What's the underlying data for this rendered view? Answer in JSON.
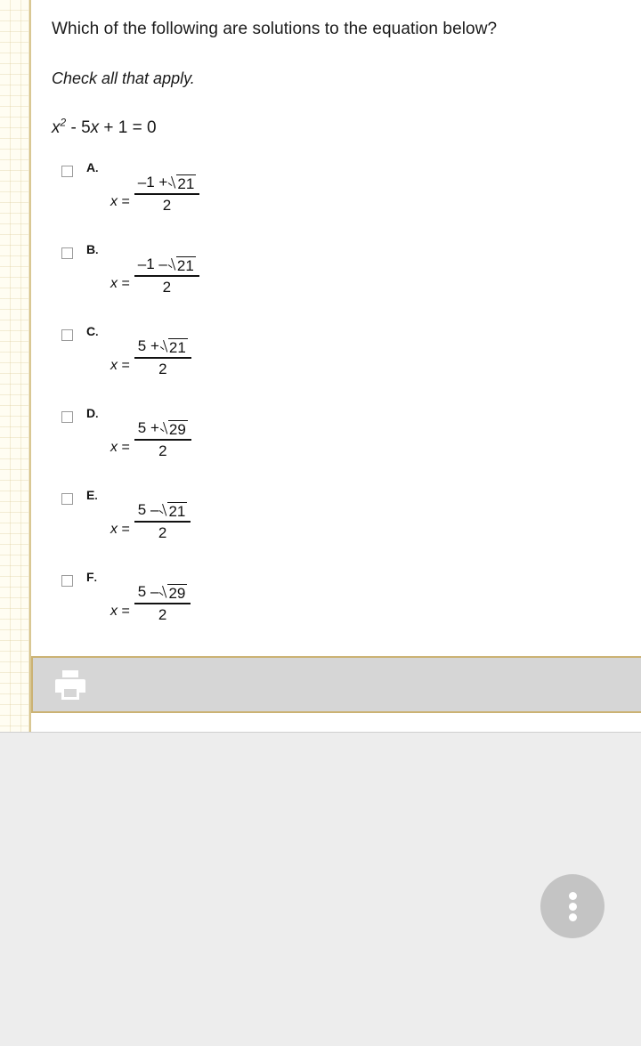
{
  "paper": {
    "margin_pattern": "graph-paper",
    "margin_color": "#fffdf2",
    "border_color": "#cbb273"
  },
  "question": {
    "prompt": "Which of the following are solutions to the equation below?",
    "instruction": "Check all that apply.",
    "equation": {
      "lhs_var": "x",
      "exponent": "2",
      "rest": " - 5x + 1 = 0",
      "full_text": "x2 - 5x + 1 = 0"
    }
  },
  "options": [
    {
      "letter": "A",
      "dot": ".",
      "lead": "x =",
      "numerator_sign": "–1 +",
      "radicand": "21",
      "denominator": "2",
      "checked": false,
      "plain": "x = (-1 + sqrt(21)) / 2"
    },
    {
      "letter": "B",
      "dot": ".",
      "lead": "x =",
      "numerator_sign": "–1 –",
      "radicand": "21",
      "denominator": "2",
      "checked": false,
      "plain": "x = (-1 - sqrt(21)) / 2"
    },
    {
      "letter": "C",
      "dot": ".",
      "lead": "x =",
      "numerator_sign": "5 +",
      "radicand": "21",
      "denominator": "2",
      "checked": false,
      "plain": "x = (5 + sqrt(21)) / 2"
    },
    {
      "letter": "D",
      "dot": ".",
      "lead": "x =",
      "numerator_sign": "5 +",
      "radicand": "29",
      "denominator": "2",
      "checked": false,
      "plain": "x = (5 + sqrt(29)) / 2"
    },
    {
      "letter": "E",
      "dot": ".",
      "lead": "x =",
      "numerator_sign": "5 –",
      "radicand": "21",
      "denominator": "2",
      "checked": false,
      "plain": "x = (5 - sqrt(21)) / 2"
    },
    {
      "letter": "F",
      "dot": ".",
      "lead": "x =",
      "numerator_sign": "5 –",
      "radicand": "29",
      "denominator": "2",
      "checked": false,
      "plain": "x = (5 - sqrt(29)) / 2"
    }
  ],
  "toolbar": {
    "background": "#d6d6d6",
    "border": "#cbb273",
    "print_icon": "print-icon"
  },
  "fab": {
    "icon": "more-vertical-icon",
    "color": "#c4c4c4",
    "dot_color": "#ffffff"
  }
}
